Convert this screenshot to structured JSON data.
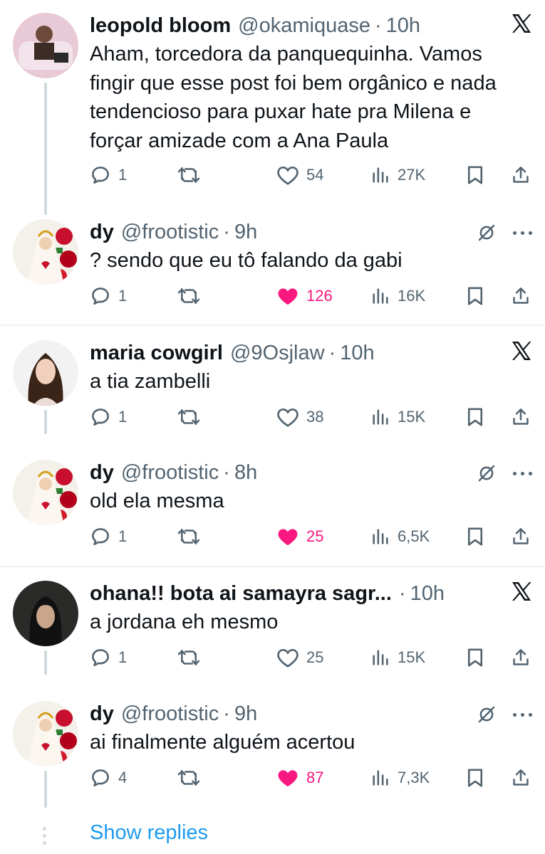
{
  "colors": {
    "text": "#0f1419",
    "muted": "#536471",
    "like_active": "#f91880",
    "link": "#1d9bf0",
    "thread_line": "#cfd9de"
  },
  "tweets": [
    {
      "name": "leopold bloom",
      "handle": "@okamiquase",
      "sep": "·",
      "time": "10h",
      "corner_icon": "x-logo-icon",
      "text": "Aham, torcedora da panquequinha. Vamos fingir que esse post foi bem orgânico e nada tendencioso para puxar hate pra Milena e forçar amizade com a Ana Paula",
      "replies": "1",
      "likes": "54",
      "liked": false,
      "views": "27K"
    },
    {
      "name": "dy",
      "handle": "@frootistic",
      "sep": "·",
      "time": "9h",
      "corner_icon": "mute-icon",
      "text": "? sendo que eu tô falando da gabi",
      "replies": "1",
      "likes": "126",
      "liked": true,
      "views": "16K"
    },
    {
      "name": "maria cowgirl",
      "handle": "@9Osjlaw",
      "sep": "·",
      "time": "10h",
      "corner_icon": "x-logo-icon",
      "text": "a tia zambelli",
      "replies": "1",
      "likes": "38",
      "liked": false,
      "views": "15K"
    },
    {
      "name": "dy",
      "handle": "@frootistic",
      "sep": "·",
      "time": "8h",
      "corner_icon": "mute-icon",
      "text": "old ela mesma",
      "replies": "1",
      "likes": "25",
      "liked": true,
      "views": "6,5K"
    },
    {
      "name": "ohana!! bota ai samayra sagr...",
      "handle": "",
      "sep": "·",
      "time": "10h",
      "corner_icon": "x-logo-icon",
      "text": "a jordana eh mesmo",
      "replies": "1",
      "likes": "25",
      "liked": false,
      "views": "15K"
    },
    {
      "name": "dy",
      "handle": "@frootistic",
      "sep": "·",
      "time": "9h",
      "corner_icon": "mute-icon",
      "text": "ai finalmente alguém acertou",
      "replies": "4",
      "likes": "87",
      "liked": true,
      "views": "7,3K"
    }
  ],
  "show_replies": "Show replies"
}
